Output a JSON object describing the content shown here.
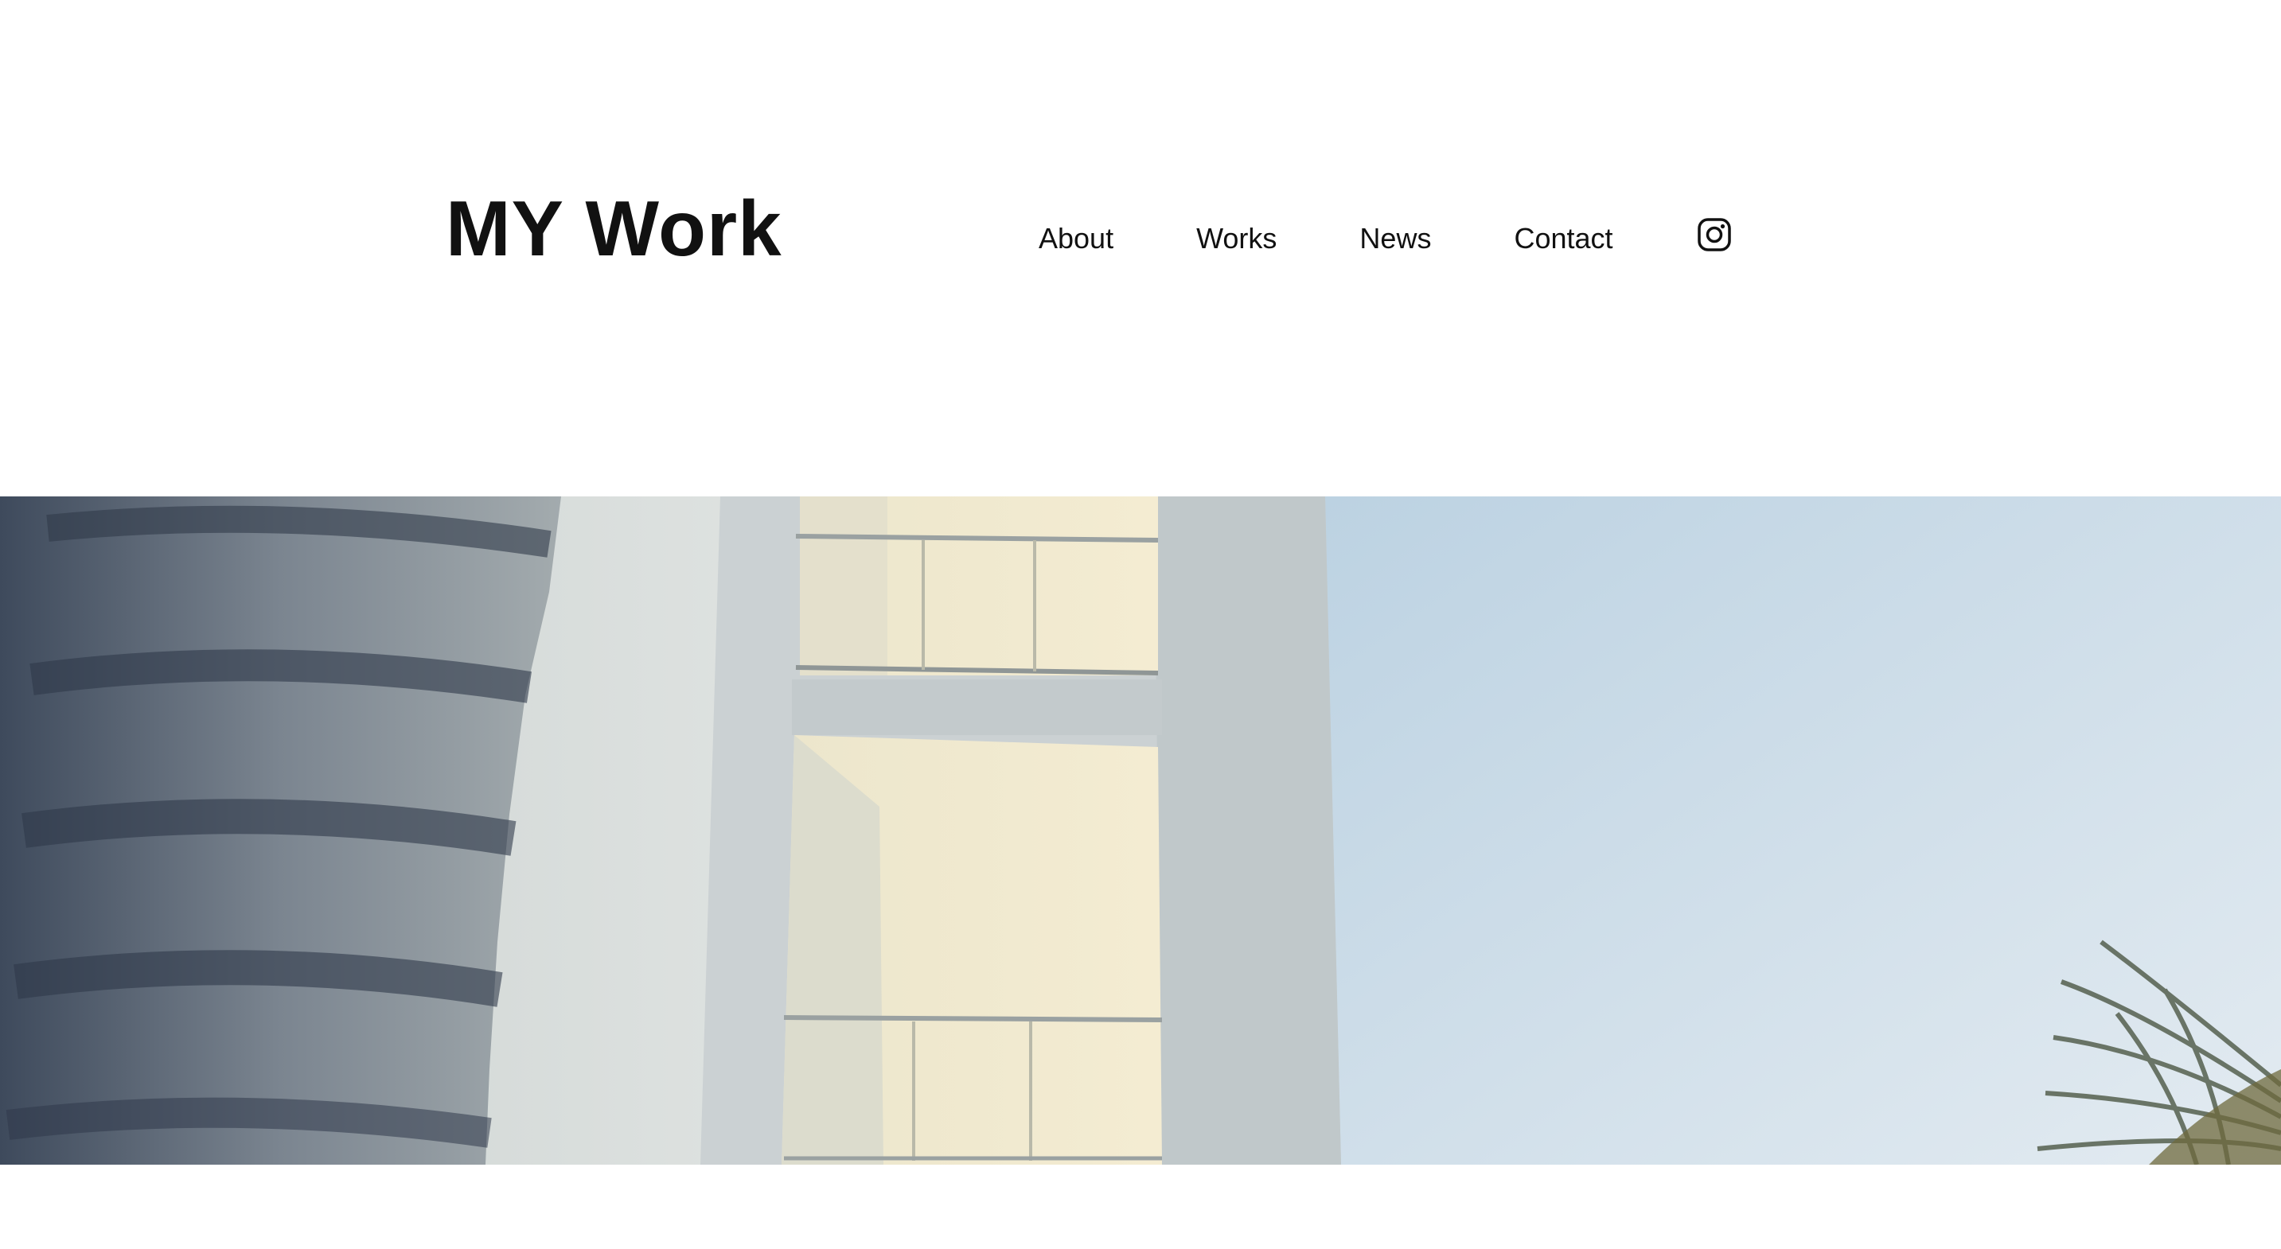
{
  "site": {
    "title": "MY Work"
  },
  "nav": {
    "items": [
      {
        "label": "About"
      },
      {
        "label": "Works"
      },
      {
        "label": "News"
      },
      {
        "label": "Contact"
      }
    ],
    "social_icon": "instagram-icon"
  },
  "hero": {
    "image_subject": "building-with-palm-trees"
  },
  "colors": {
    "text": "#111111",
    "background": "#ffffff",
    "sky": "#d4e2ec"
  }
}
